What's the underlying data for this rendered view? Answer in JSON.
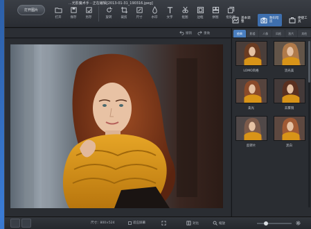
{
  "window": {
    "title": "...光影魔术手 - 正在编辑[2013-01-31_190316.jpeg]"
  },
  "open_button": "打开图片",
  "toolbar": [
    {
      "label": "打开",
      "icon": "folder-icon"
    },
    {
      "label": "保存",
      "icon": "save-icon"
    },
    {
      "label": "另存",
      "icon": "save-as-icon"
    },
    {
      "label": "旋转",
      "icon": "rotate-icon"
    },
    {
      "label": "裁剪",
      "icon": "crop-icon"
    },
    {
      "label": "尺寸",
      "icon": "resize-icon"
    },
    {
      "label": "水印",
      "icon": "watermark-icon"
    },
    {
      "label": "文字",
      "icon": "text-icon"
    },
    {
      "label": "抠图",
      "icon": "cutout-icon"
    },
    {
      "label": "边框",
      "icon": "frame-icon"
    },
    {
      "label": "拼图",
      "icon": "collage-icon"
    },
    {
      "label": "批处理",
      "icon": "batch-icon"
    }
  ],
  "right_tools": [
    {
      "label": "基本调整",
      "icon": "adjust-icon"
    },
    {
      "label": "数码暗房",
      "icon": "camera-icon",
      "active": true
    },
    {
      "label": "便捷工具",
      "icon": "toolbox-icon"
    }
  ],
  "subbar": {
    "undo": "撤销",
    "redo": "重做"
  },
  "panel": {
    "tabs": [
      {
        "label": "经典",
        "active": true
      },
      {
        "label": "影楼"
      },
      {
        "label": "人像"
      },
      {
        "label": "风格"
      },
      {
        "label": "胶片"
      },
      {
        "label": "其他"
      }
    ],
    "effects": [
      {
        "label": "LOMO风格",
        "tint": "#6b3c22"
      },
      {
        "label": "流光美",
        "tint": "#b07a4a"
      },
      {
        "label": "柔光",
        "tint": "#8a4a2a"
      },
      {
        "label": "去雾镜",
        "tint": "#5a3020"
      },
      {
        "label": "反转片",
        "tint": "#7c5a4a"
      },
      {
        "label": "黑白",
        "tint": "#a05a34"
      }
    ]
  },
  "status": {
    "size": "尺寸：800×524",
    "fit_label": "适应屏幕",
    "compare": "对比",
    "zoom_label": "缩放"
  },
  "colors": {
    "accent": "#3e6fae",
    "scarf": "#d89418",
    "hair": "#7a3a1c"
  }
}
